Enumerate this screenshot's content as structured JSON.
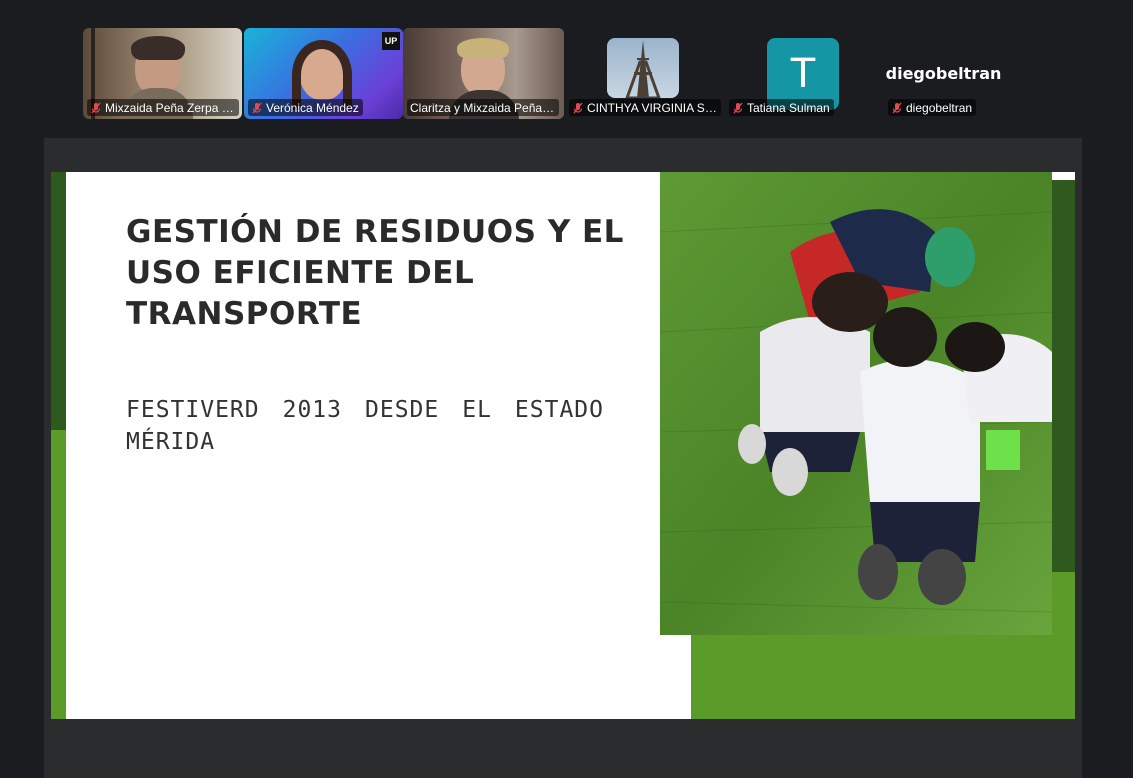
{
  "participants": [
    {
      "name": "Mixzaida Peña Zerpa (...",
      "muted": true,
      "type": "video"
    },
    {
      "name": "Verónica Méndez",
      "muted": true,
      "type": "video",
      "badge": "UP"
    },
    {
      "name": "Claritza y Mixzaida Peña Z...",
      "muted": true,
      "type": "video",
      "active": true
    },
    {
      "name": "CINTHYA VIRGINIA SO...",
      "muted": true,
      "type": "video"
    },
    {
      "name": "Tatiana Sulman",
      "muted": true,
      "type": "avatar",
      "initial": "T"
    },
    {
      "name": "diegobeltran",
      "muted": true,
      "type": "name-only",
      "display": "diegobeltran"
    }
  ],
  "slide": {
    "title": "GESTIÓN DE RESIDUOS Y EL USO EFICIENTE DEL TRANSPORTE",
    "subtitle": "FESTIVERD 2013 DESDE EL ESTADO MÉRIDA"
  },
  "colors": {
    "accent_green": "#5b9b2a",
    "dark_green": "#2f5a1d",
    "active_speaker": "#35d07f",
    "avatar_teal": "#1596a4"
  }
}
